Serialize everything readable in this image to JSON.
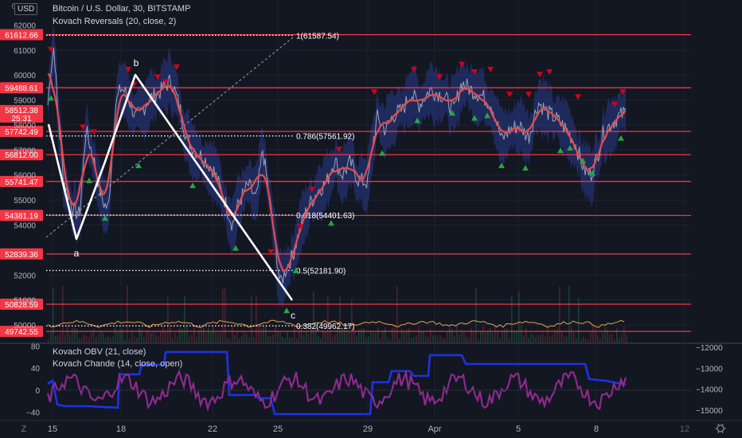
{
  "header": {
    "currency": "USD",
    "symbol_line": "Bitcoin / U.S. Dollar, 30, BITSTAMP",
    "indicator_line": "Kovach Reversals (20, close, 2)"
  },
  "price_pane": {
    "left_axis_ticks": [
      61000,
      60000,
      59000,
      58000,
      57000,
      56000,
      55000,
      54000,
      52000,
      51000,
      50000
    ],
    "top_partial_tick": "63000",
    "faded_ticks": [
      "62000"
    ],
    "current_price": "58512.38",
    "countdown": "25:31",
    "level_badges": [
      "61612.66",
      "59488.61",
      "57742.49",
      "56812.00",
      "55741.47",
      "54381.19",
      "52839.36",
      "50828.59",
      "49742.55"
    ],
    "level_values": [
      61612.66,
      59488.61,
      57742.49,
      56812.0,
      55741.47,
      54381.19,
      52839.36,
      50828.59,
      49742.55
    ],
    "fib_labels": [
      "1(61587.54)",
      "0.786(57561.92)",
      "0.618(54401.63)",
      "0.5(52181.90)",
      "0.382(49962.17)"
    ],
    "fib_values": [
      61587.54,
      57561.92,
      54401.63,
      52181.9,
      49962.17
    ],
    "wave_labels": [
      "a",
      "b",
      "c"
    ],
    "colors": {
      "level": "#f23645",
      "badge": "#f23645",
      "wave": "#ffffff",
      "ma": "#e84a4a",
      "band": "#2a3a8c",
      "up_marker": "#26a641",
      "down_marker": "#d0021b",
      "volume_line": "#e8a04a"
    }
  },
  "x_axis": {
    "labels": [
      "15",
      "18",
      "22",
      "25",
      "29",
      "Apr",
      "5",
      "8",
      "12"
    ],
    "timezone_icon": "Z",
    "settings_icon": "gear-icon"
  },
  "indicator_pane": {
    "title1": "Kovach OBV (21, close)",
    "title2": "Kovach Chande (14, close, open)",
    "left_ticks": [
      "80",
      "40",
      "0",
      "−40"
    ],
    "right_ticks": [
      "−12000",
      "−13000",
      "−14000",
      "−15000"
    ],
    "obv_color": "#1e32e6",
    "chande_color": "#8e2a8e"
  },
  "chart_data": [
    {
      "type": "line",
      "title": "Bitcoin / U.S. Dollar, 30, BITSTAMP",
      "x": [
        "15",
        "18",
        "22",
        "25",
        "29",
        "Apr",
        "5",
        "8"
      ],
      "series": [
        {
          "name": "Bitcoin / U.S. Dollar",
          "values": [
            59500,
            59700,
            57800,
            54400,
            57800,
            59500,
            57400,
            58512.38
          ]
        }
      ],
      "wave_points": [
        {
          "label": "a",
          "value": 53200
        },
        {
          "label": "b",
          "value": 60100
        },
        {
          "label": "c",
          "value": 50700
        }
      ],
      "horizontal_levels": [
        61612.66,
        59488.61,
        57742.49,
        56812.0,
        55741.47,
        54381.19,
        52839.36,
        50828.59,
        49742.55
      ],
      "fib_levels": [
        {
          "ratio": 1,
          "value": 61587.54
        },
        {
          "ratio": 0.786,
          "value": 57561.92
        },
        {
          "ratio": 0.618,
          "value": 54401.63
        },
        {
          "ratio": 0.5,
          "value": 52181.9
        },
        {
          "ratio": 0.382,
          "value": 49962.17
        }
      ],
      "ylim": [
        49300,
        63000
      ]
    },
    {
      "type": "line",
      "x": [
        "15",
        "18",
        "22",
        "25",
        "29",
        "Apr",
        "5",
        "8"
      ],
      "series": [
        {
          "name": "Kovach OBV (21, close)",
          "values": [
            -14500,
            -13200,
            -13600,
            -15100,
            -14000,
            -13500,
            -13500,
            -13900
          ]
        },
        {
          "name": "Kovach Chande (14, close, open)",
          "values": [
            5,
            10,
            -5,
            -30,
            20,
            10,
            0,
            -10
          ]
        }
      ],
      "ylim_left": [
        -55,
        85
      ],
      "ylim_right": [
        -15500,
        -11800
      ]
    }
  ]
}
